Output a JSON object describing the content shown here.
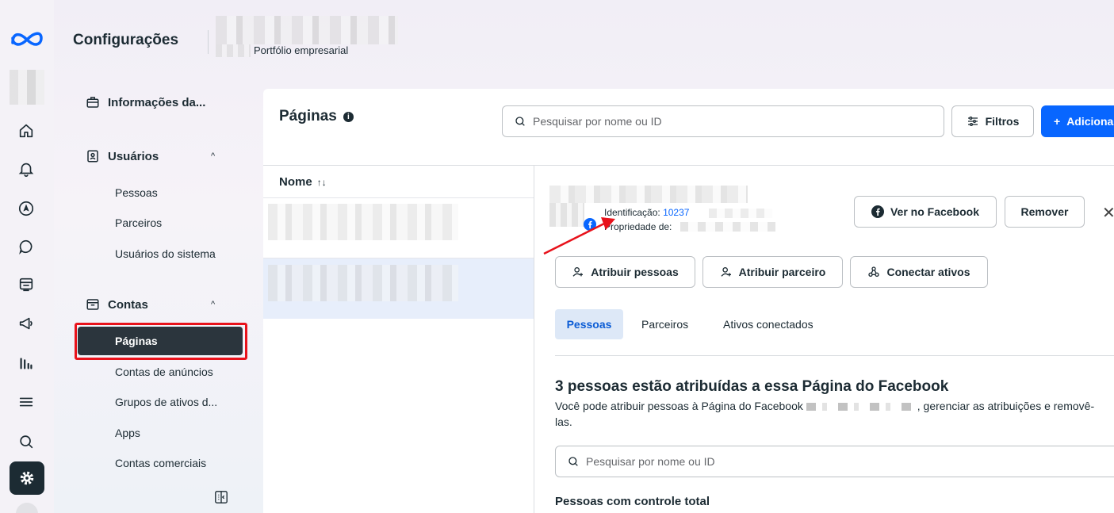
{
  "header": {
    "title": "Configurações",
    "business_subtitle": "Portfólio empresarial"
  },
  "sidebar": {
    "business_info": "Informações da...",
    "users_group": "Usuários",
    "users_items": [
      "Pessoas",
      "Parceiros",
      "Usuários do sistema"
    ],
    "accounts_group": "Contas",
    "accounts_items": [
      "Páginas",
      "Contas de anúncios",
      "Grupos de ativos d...",
      "Apps",
      "Contas comerciais"
    ],
    "active_item": "Páginas"
  },
  "main": {
    "title": "Páginas",
    "search_placeholder": "Pesquisar por nome ou ID",
    "filters_label": "Filtros",
    "add_label": "Adicionar",
    "column_name": "Nome",
    "sort_glyph": "↑↓"
  },
  "detail": {
    "id_label": "Identificação:",
    "id_value": "10237",
    "owner_label": "Propriedade de:",
    "view_on_facebook": "Ver no Facebook",
    "remove": "Remover",
    "close_glyph": "✕",
    "assign_people": "Atribuir pessoas",
    "assign_partner": "Atribuir parceiro",
    "connect_assets": "Conectar ativos",
    "tabs": [
      "Pessoas",
      "Parceiros",
      "Ativos conectados"
    ],
    "heading": "3 pessoas estão atribuídas a essa Página do Facebook",
    "paragraph_start": "Você pode atribuir pessoas à Página do Facebook",
    "paragraph_end": ", gerenciar as atribuições e removê-las.",
    "search_placeholder": "Pesquisar por nome ou ID",
    "full_control_heading": "Pessoas com controle total"
  },
  "colors": {
    "accent": "#0866ff",
    "highlight_red": "#e8121b",
    "active_sidebar": "#2b353d"
  },
  "icons": [
    "meta-logo-icon",
    "home-icon",
    "bell-icon",
    "compass-icon",
    "chat-icon",
    "pages-icon",
    "megaphone-icon",
    "analytics-icon",
    "menu-icon",
    "search-icon",
    "settings-icon",
    "briefcase-icon",
    "user-badge-icon",
    "folder-icon",
    "collapse-icon",
    "info-icon",
    "filter-icon",
    "plus-icon",
    "facebook-icon",
    "assign-person-icon",
    "connect-assets-icon",
    "close-icon"
  ]
}
